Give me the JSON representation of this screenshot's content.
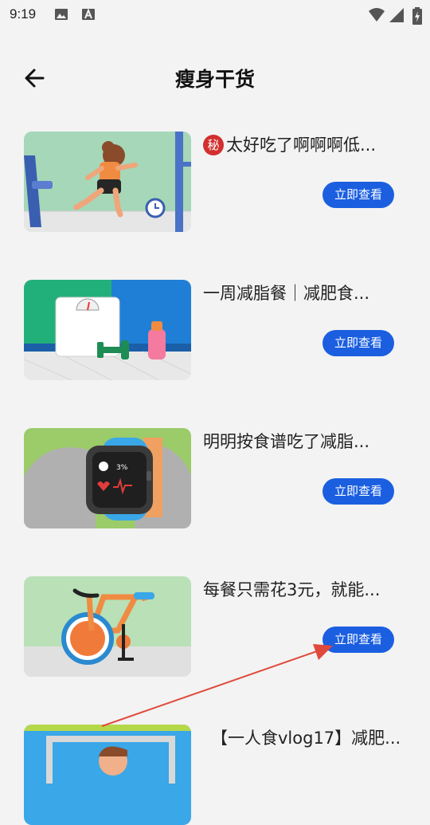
{
  "status_bar": {
    "time": "9:19"
  },
  "header": {
    "title": "瘦身干货"
  },
  "articles": [
    {
      "badge": "秘",
      "title": "太好吃了啊啊啊低...",
      "button": "立即查看"
    },
    {
      "title": "一周减脂餐｜减肥食...",
      "button": "立即查看"
    },
    {
      "title": "明明按食谱吃了减脂...",
      "button": "立即查看"
    },
    {
      "title": "每餐只需花3元，就能...",
      "button": "立即查看"
    },
    {
      "title": "【一人食vlog17】减肥..."
    }
  ],
  "colors": {
    "accent": "#1b5fe0",
    "badge": "#d32f2f",
    "annotation_arrow": "#e04a3c"
  }
}
